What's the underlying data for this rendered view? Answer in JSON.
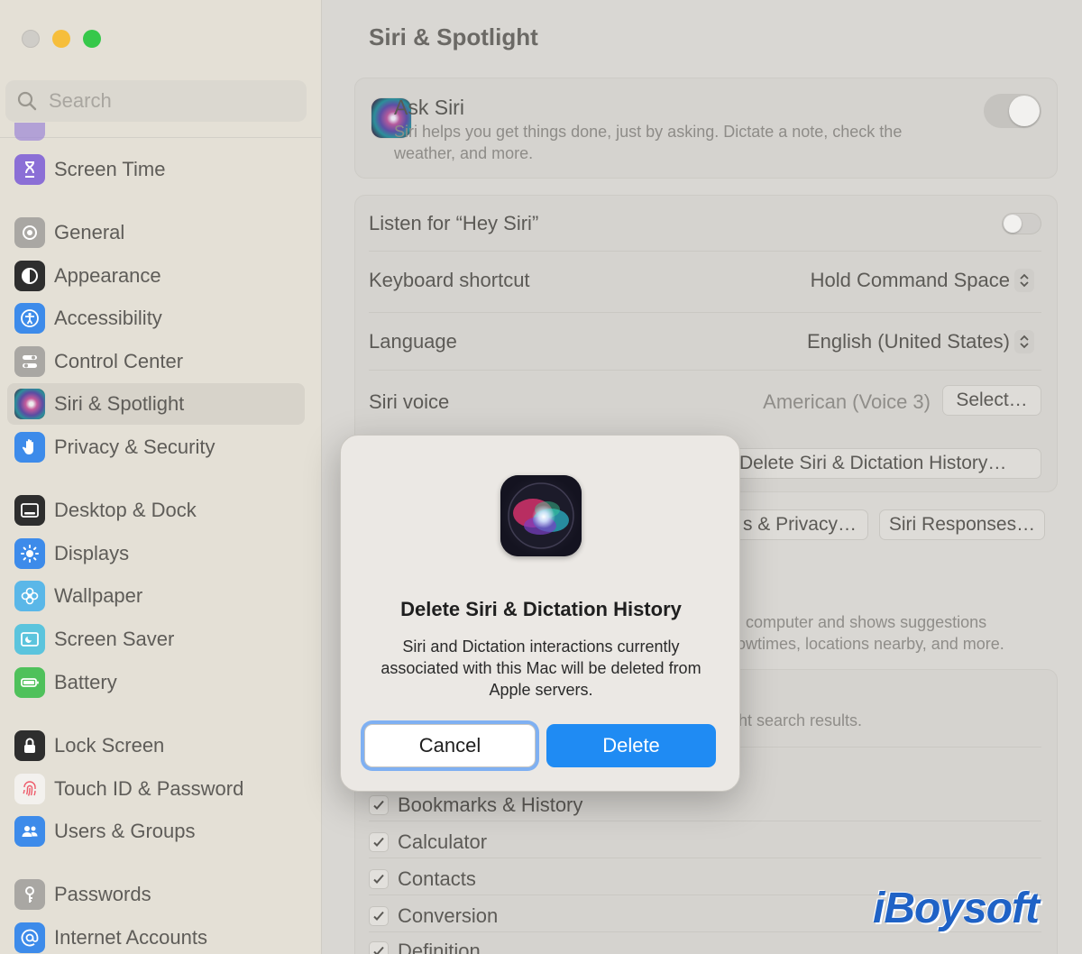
{
  "window": {
    "traffic_lights": [
      "close",
      "minimize",
      "zoom"
    ]
  },
  "sidebar": {
    "search_placeholder": "Search",
    "items": [
      {
        "label": "Screen Time",
        "icon": "hourglass-icon",
        "color": "#8b6fd6"
      },
      {
        "label": "General",
        "icon": "gear-icon",
        "color": "#9c9a97"
      },
      {
        "label": "Appearance",
        "icon": "appearance-icon",
        "color": "#2a2a2a"
      },
      {
        "label": "Accessibility",
        "icon": "accessibility-icon",
        "color": "#3d8bea"
      },
      {
        "label": "Control Center",
        "icon": "control-center-icon",
        "color": "#9c9a97"
      },
      {
        "label": "Siri & Spotlight",
        "icon": "siri-icon",
        "color": "#7b4fa8"
      },
      {
        "label": "Privacy & Security",
        "icon": "hand-icon",
        "color": "#3d8bea"
      },
      {
        "label": "Desktop & Dock",
        "icon": "dock-icon",
        "color": "#2a2a2a"
      },
      {
        "label": "Displays",
        "icon": "sun-icon",
        "color": "#3d8bea"
      },
      {
        "label": "Wallpaper",
        "icon": "flower-icon",
        "color": "#5ab7e8"
      },
      {
        "label": "Screen Saver",
        "icon": "screen-saver-icon",
        "color": "#5bc4dd"
      },
      {
        "label": "Battery",
        "icon": "battery-icon",
        "color": "#4fc15b"
      },
      {
        "label": "Lock Screen",
        "icon": "lock-icon",
        "color": "#2a2a2a"
      },
      {
        "label": "Touch ID & Password",
        "icon": "fingerprint-icon",
        "color": "#ee5b6a"
      },
      {
        "label": "Users & Groups",
        "icon": "users-icon",
        "color": "#3d8bea"
      },
      {
        "label": "Passwords",
        "icon": "key-icon",
        "color": "#9c9a97"
      },
      {
        "label": "Internet Accounts",
        "icon": "at-icon",
        "color": "#3d8bea"
      }
    ]
  },
  "main": {
    "title": "Siri & Spotlight",
    "ask_siri": {
      "title": "Ask Siri",
      "description": "Siri helps you get things done, just by asking. Dictate a note, check the weather, and more.",
      "enabled": true
    },
    "hey_siri": {
      "label": "Listen for “Hey Siri”",
      "enabled": false
    },
    "keyboard_shortcut": {
      "label": "Keyboard shortcut",
      "value": "Hold Command Space"
    },
    "language": {
      "label": "Language",
      "value": "English (United States)"
    },
    "siri_voice": {
      "label": "Siri voice",
      "value": "American (Voice 3)",
      "button": "Select…"
    },
    "delete_history_button": "Delete Siri & Dictation History…",
    "privacy_button_partial": "s & Privacy…",
    "siri_responses_button": "Siri Responses…",
    "suggestions_text_line1": "computer and shows suggestions",
    "suggestions_text_line2": "owtimes, locations nearby, and more.",
    "search_results_partial": "ht search results.",
    "checkboxes": [
      {
        "label": "Bookmarks & History",
        "checked": true
      },
      {
        "label": "Calculator",
        "checked": true
      },
      {
        "label": "Contacts",
        "checked": true
      },
      {
        "label": "Conversion",
        "checked": true
      },
      {
        "label": "Definition",
        "checked": true
      }
    ],
    "watermark": "iBoysoft"
  },
  "dialog": {
    "title": "Delete Siri & Dictation History",
    "message": "Siri and Dictation interactions currently associated with this Mac will be deleted from Apple servers.",
    "cancel_label": "Cancel",
    "delete_label": "Delete"
  },
  "colors": {
    "accent": "#1f8bf3",
    "focus_ring": "#7fb0f2",
    "watermark": "#1f62c6"
  }
}
